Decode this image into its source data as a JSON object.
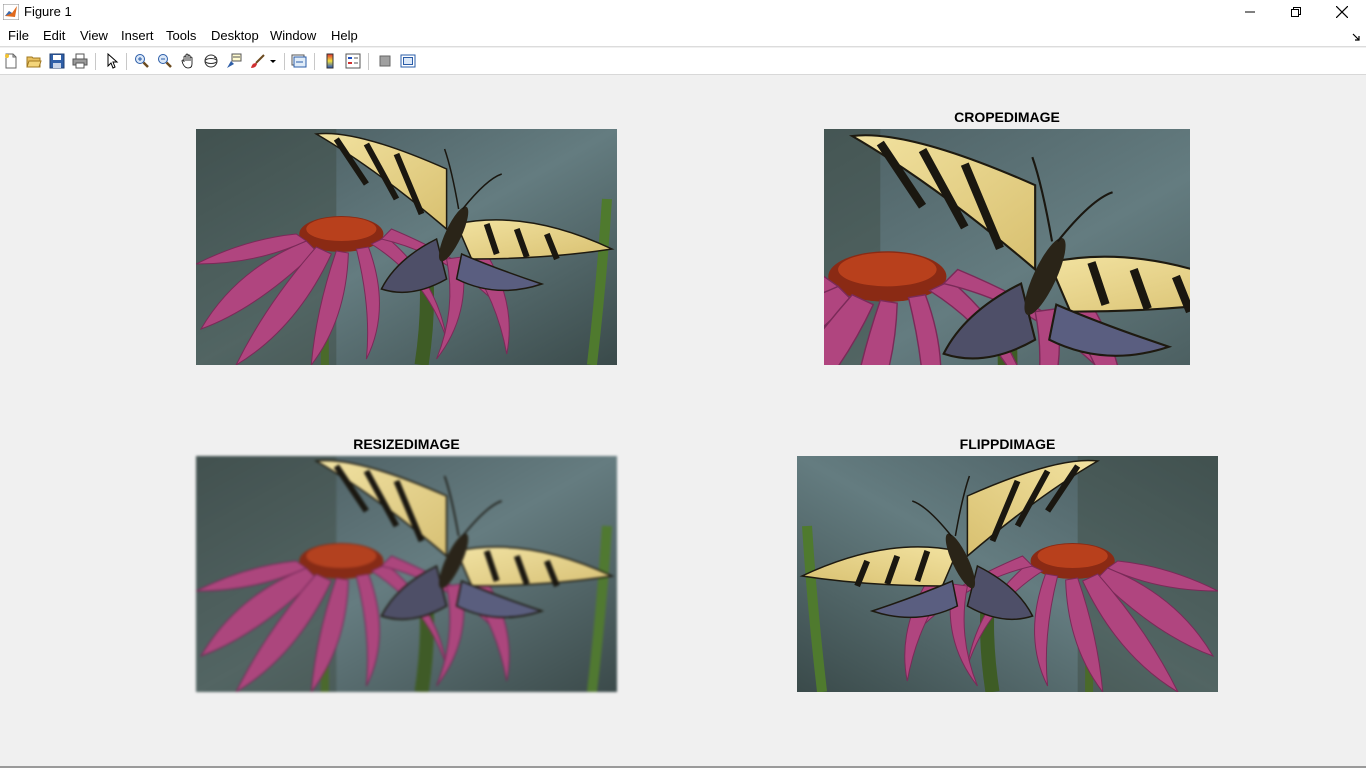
{
  "window": {
    "title": "Figure 1"
  },
  "menu": {
    "items": [
      "File",
      "Edit",
      "View",
      "Insert",
      "Tools",
      "Desktop",
      "Window",
      "Help"
    ]
  },
  "toolbar": {
    "icons": [
      "new-figure-icon",
      "open-file-icon",
      "save-icon",
      "print-icon",
      "edit-plot-arrow-icon",
      "zoom-in-icon",
      "zoom-out-icon",
      "pan-hand-icon",
      "rotate-3d-icon",
      "data-cursor-icon",
      "brush-icon",
      "link-plot-icon",
      "insert-colorbar-icon",
      "insert-legend-icon",
      "hide-plot-tools-icon",
      "show-plot-tools-icon"
    ]
  },
  "axes": [
    {
      "title": ""
    },
    {
      "title": "CROPEDIMAGE"
    },
    {
      "title": "RESIZEDIMAGE"
    },
    {
      "title": "FLIPPDIMAGE"
    }
  ],
  "colors": {
    "figure_bg": "#f0f0f0",
    "wing_yellow": "#e8d48a",
    "flower_pink": "#b0457f",
    "background_teal": "#5a7074"
  }
}
